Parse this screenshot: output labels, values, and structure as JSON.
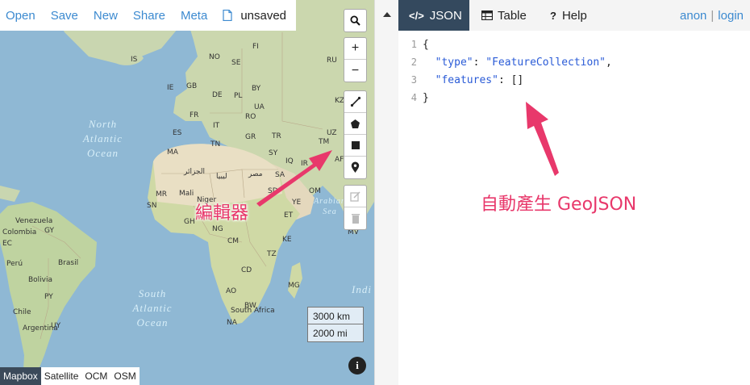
{
  "toolbar": {
    "open": "Open",
    "save": "Save",
    "new": "New",
    "share": "Share",
    "meta": "Meta",
    "file_name": "unsaved"
  },
  "map": {
    "labels": {
      "uz": "UZ",
      "tm": "TM",
      "af": "AF",
      "kz": "KZ",
      "ua": "UA",
      "pl": "PL",
      "fi": "FI",
      "se": "SE",
      "is": "IS",
      "sy": "SY",
      "ir": "IR",
      "iq": "IQ",
      "ye": "YE",
      "sd": "SD",
      "et": "ET",
      "mv": "MV",
      "mg": "MG",
      "mr": "MR",
      "mali": "Mali",
      "niger": "Niger",
      "ng": "NG",
      "sn": "SN",
      "gh": "GH",
      "cm": "CM",
      "cd": "CD",
      "ao": "AO",
      "na": "NA",
      "bw": "BW",
      "za": "South Africa",
      "tz": "TZ",
      "ke": "KE",
      "eg": "مصر",
      "ly": "ليبيا",
      "dz": "الجزائر",
      "tn": "TN",
      "ma": "MA",
      "es": "ES",
      "fr": "FR",
      "de": "DE",
      "it": "IT",
      "gb": "GB",
      "ie": "IE",
      "no": "NO",
      "tr": "TR",
      "gr": "GR",
      "ro": "RO",
      "by": "BY",
      "ru": "RU",
      "ve": "Venezuela",
      "co": "Colombia",
      "pe": "Perú",
      "br": "Brasil",
      "bo": "Bolivia",
      "py": "PY",
      "cl": "Chile",
      "ar": "Argentina",
      "uy": "UY",
      "ec": "EC",
      "gy": "GY",
      "sa": "SA",
      "om": "OM"
    },
    "oceans": {
      "north_atlantic": "North Atlantic Ocean",
      "south_atlantic": "South Atlantic Ocean",
      "arabian_sea": "Arabian Sea",
      "indian": "Indi"
    },
    "controls": {
      "search": "search",
      "zoom_in": "+",
      "zoom_out": "−"
    },
    "scale": {
      "km": "3000 km",
      "mi": "2000 mi"
    },
    "info": "i",
    "layers": [
      "Mapbox",
      "Satellite",
      "OCM",
      "OSM"
    ],
    "active_layer": "Mapbox"
  },
  "tabs": {
    "json": "JSON",
    "json_icon": "</>",
    "table": "Table",
    "help": "Help",
    "help_icon": "?"
  },
  "auth": {
    "anon": "anon",
    "sep": "|",
    "login": "login"
  },
  "editor": {
    "lines": [
      {
        "n": "1",
        "text": "{"
      },
      {
        "n": "2",
        "key": "\"type\"",
        "colon": ": ",
        "value": "\"FeatureCollection\"",
        "tail": ","
      },
      {
        "n": "3",
        "key": "\"features\"",
        "colon": ": ",
        "value": "[]",
        "tail": ""
      },
      {
        "n": "4",
        "text": "}"
      }
    ]
  },
  "annotations": {
    "editor_label": "編輯器",
    "auto_label": "自動產生 GeoJSON",
    "color": "#e8386b"
  }
}
